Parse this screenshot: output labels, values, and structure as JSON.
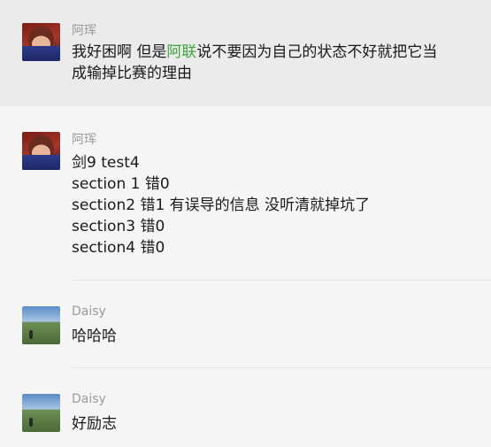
{
  "messages": [
    {
      "sender": "阿珲",
      "lines": [
        {
          "before": "我好困啊 但是",
          "mention": "阿联",
          "after": "说不要因为自己的状态不好就把它当"
        },
        {
          "text": "成输掉比赛的理由"
        }
      ]
    },
    {
      "sender": "阿珲",
      "lines": [
        {
          "text": "剑9 test4"
        },
        {
          "text": "section 1 错0"
        },
        {
          "text": "section2 错1 有误导的信息 没听清就掉坑了"
        },
        {
          "text": "section3 错0"
        },
        {
          "text": "section4 错0"
        }
      ]
    },
    {
      "sender": "Daisy",
      "lines": [
        {
          "text": "哈哈哈"
        }
      ]
    },
    {
      "sender": "Daisy",
      "lines": [
        {
          "text": "好励志"
        }
      ]
    }
  ],
  "colors": {
    "background": "#f5f5f5",
    "highlight": "#ebebeb",
    "mention": "#3ca63c",
    "sender": "#9b9b9b",
    "text": "#1a1a1a"
  }
}
